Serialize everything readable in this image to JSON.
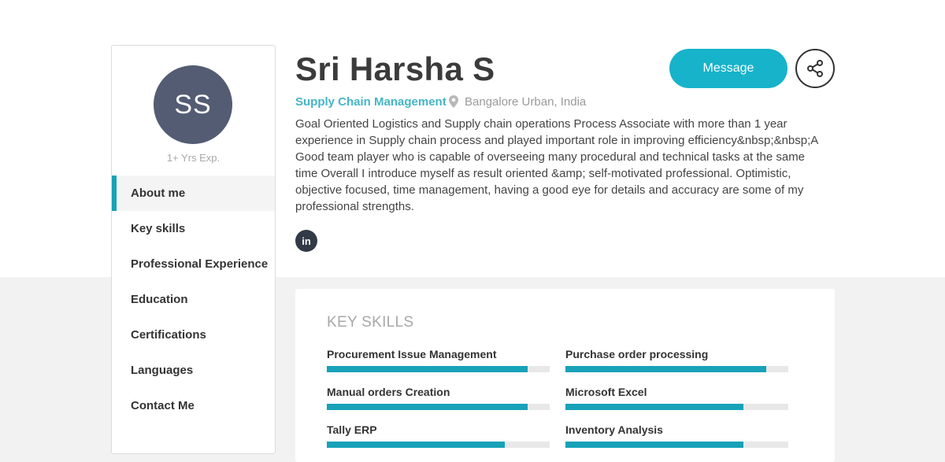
{
  "profile": {
    "initials": "SS",
    "experience": "1+ Yrs Exp.",
    "name": "Sri Harsha S",
    "role": "Supply Chain Management",
    "location": "Bangalore Urban, India",
    "summary": "Goal Oriented Logistics and Supply chain operations Process Associate with more than 1 year experience in Supply chain process and played important role in improving efficiency&nbsp;&nbsp;A Good team player who is capable of overseeing many procedural and technical tasks at the same time Overall I introduce myself as result oriented &amp; self-motivated professional. Optimistic, objective focused, time management, having a good eye for details and accuracy are some of my professional strengths.",
    "linkedin_icon": "linkedin-icon"
  },
  "actions": {
    "message_label": "Message",
    "share_icon": "share-icon"
  },
  "nav": {
    "items": [
      {
        "label": "About me",
        "active": true
      },
      {
        "label": "Key skills",
        "active": false
      },
      {
        "label": "Professional Experience",
        "active": false
      },
      {
        "label": "Education",
        "active": false
      },
      {
        "label": "Certifications",
        "active": false
      },
      {
        "label": "Languages",
        "active": false
      },
      {
        "label": "Contact Me",
        "active": false
      }
    ]
  },
  "key_skills": {
    "title": "KEY SKILLS",
    "skills": [
      {
        "name": "Procurement Issue Management",
        "level": 0.9
      },
      {
        "name": "Purchase order processing",
        "level": 0.9
      },
      {
        "name": "Manual orders Creation",
        "level": 0.9
      },
      {
        "name": "Microsoft Excel",
        "level": 0.8
      },
      {
        "name": "Tally ERP",
        "level": 0.8
      },
      {
        "name": "Inventory Analysis",
        "level": 0.8
      }
    ]
  },
  "colors": {
    "accent": "#17a2b8",
    "avatar": "#535c73"
  }
}
